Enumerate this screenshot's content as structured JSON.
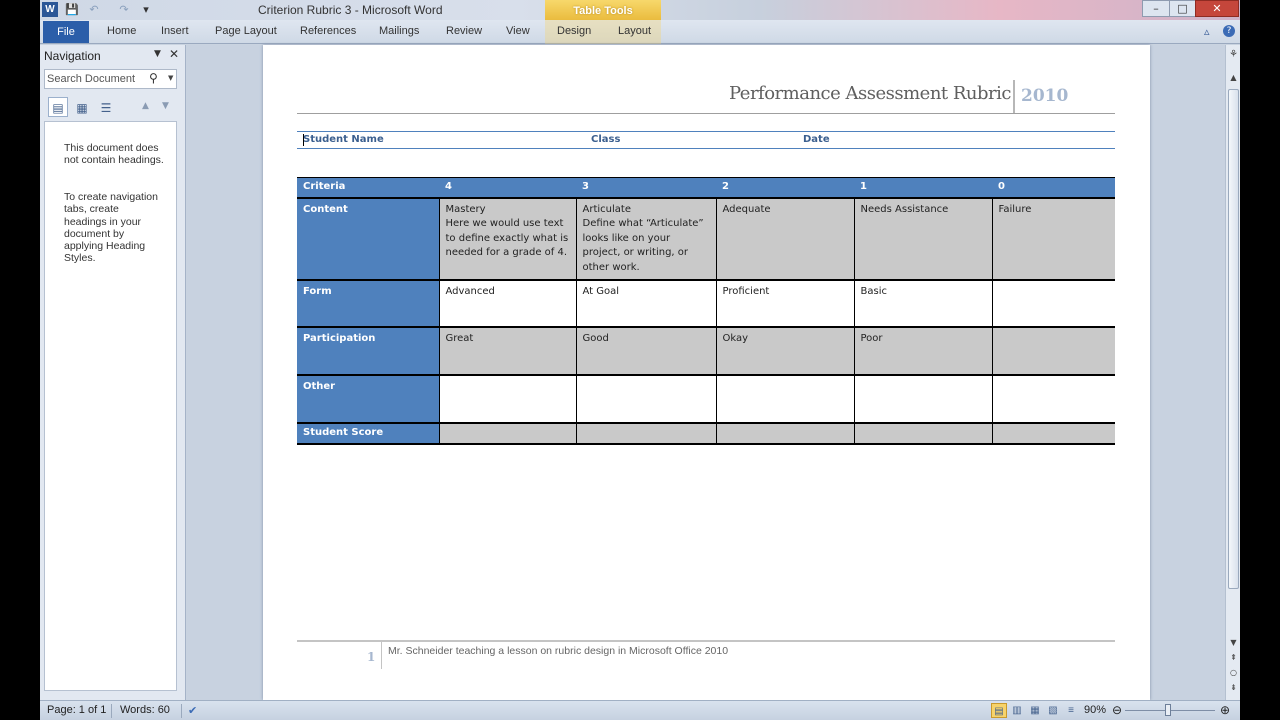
{
  "window": {
    "title": "Criterion Rubric 3  -  Microsoft Word",
    "context_tab": "Table Tools",
    "min_glyph": "–",
    "max_glyph": "□",
    "close_glyph": "✕"
  },
  "qat": {
    "word_logo": "W",
    "save_glyph": "💾",
    "undo_glyph": "↶",
    "redo_glyph": "↷",
    "custom_glyph": "▾"
  },
  "ribbon": {
    "file_label": "File",
    "tabs": [
      "Home",
      "Insert",
      "Page Layout",
      "References",
      "Mailings",
      "Review",
      "View",
      "Design",
      "Layout"
    ],
    "minimize_glyph": "▵",
    "help_glyph": "?"
  },
  "navigation": {
    "title": "Navigation",
    "menu_glyph": "▼",
    "close_glyph": "✕",
    "search_placeholder": "Search Document",
    "search_glyph": "⚲",
    "dropdown_glyph": "▼",
    "view_glyphs": [
      "▤",
      "▦",
      "☰"
    ],
    "up_glyph": "▲",
    "down_glyph": "▼",
    "message1": "This document does not contain headings.",
    "message2": "To create navigation tabs, create headings in your document by applying Heading Styles."
  },
  "document": {
    "header_title": "Performance Assessment Rubric",
    "header_year": "2010",
    "student_name_label": "Student Name",
    "class_label": "Class",
    "date_label": "Date",
    "table": {
      "headers": [
        "Criteria",
        "4",
        "3",
        "2",
        "1",
        "0"
      ],
      "rows": [
        {
          "criterion": "Content",
          "cells": [
            "Mastery\nHere we would use text to define exactly what is needed for a grade of 4.",
            "Articulate\nDefine what “Articulate” looks like on your project, or writing, or other work.",
            "Adequate",
            "Needs Assistance",
            "Failure"
          ]
        },
        {
          "criterion": "Form",
          "cells": [
            "Advanced",
            "At Goal",
            "Proficient",
            "Basic",
            ""
          ]
        },
        {
          "criterion": "Participation",
          "cells": [
            "Great",
            "Good",
            "Okay",
            "Poor",
            ""
          ]
        },
        {
          "criterion": "Other",
          "cells": [
            "",
            "",
            "",
            "",
            ""
          ]
        },
        {
          "criterion": "Student Score",
          "cells": [
            "",
            "",
            "",
            "",
            ""
          ]
        }
      ]
    },
    "footer_page_num": "1",
    "footer_text": "Mr. Schneider teaching a lesson on rubric design in Microsoft Office 2010"
  },
  "scrollbar": {
    "up_glyph": "▲",
    "down_glyph": "▼",
    "prev_glyph": "⇞",
    "browse_glyph": "○",
    "next_glyph": "⇟",
    "ruler_glyph": "⚘"
  },
  "status": {
    "page": "Page: 1 of 1",
    "words": "Words: 60",
    "proof_glyph": "✔",
    "view_glyphs": [
      "▤",
      "▥",
      "▦",
      "▧",
      "≡"
    ],
    "zoom": "90%",
    "zoom_out": "⊖",
    "zoom_in": "⊕"
  },
  "colors": {
    "table_header_blue": "#4f81bd",
    "grey_row": "#c9c9c9",
    "file_tab": "#2b5ea9",
    "close_button": "#c5463b"
  }
}
